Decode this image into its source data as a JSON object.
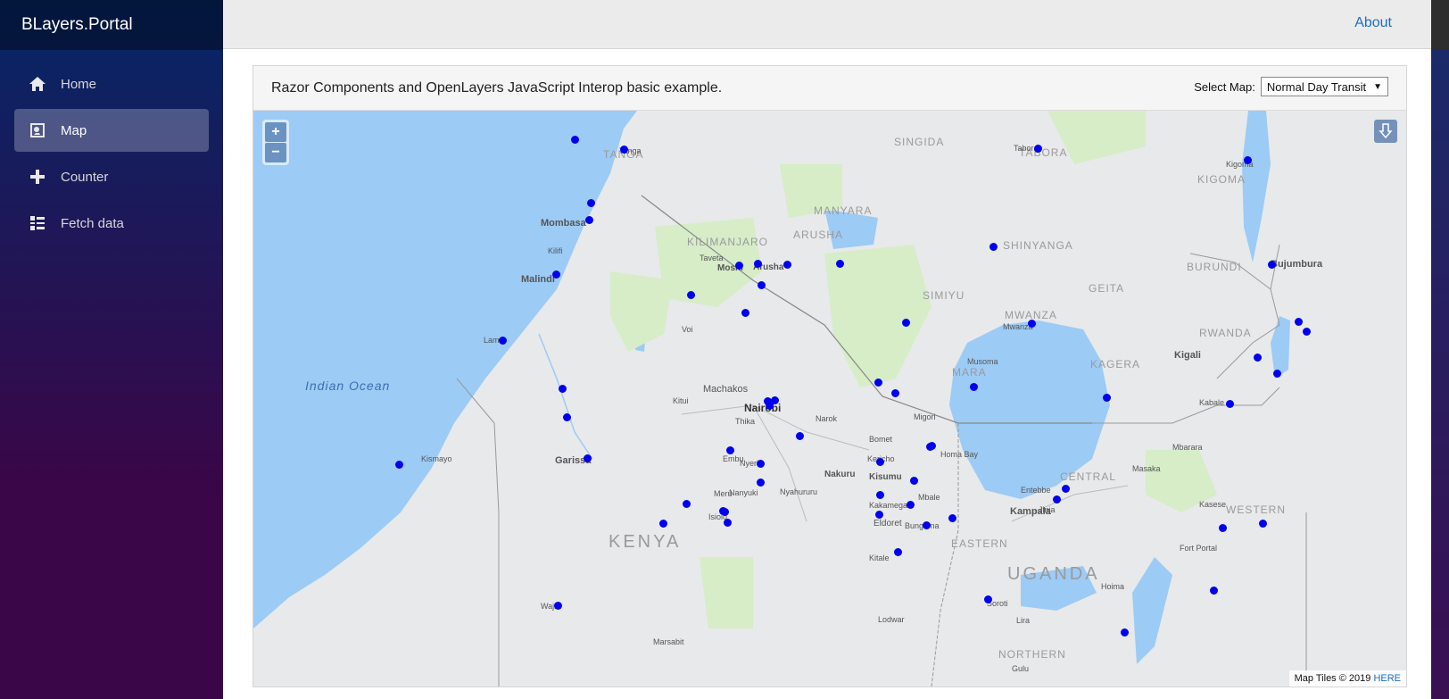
{
  "app": {
    "brand": "BLayers.Portal"
  },
  "sidebar": {
    "items": [
      {
        "label": "Home",
        "icon": "home-icon",
        "active": false
      },
      {
        "label": "Map",
        "icon": "map-icon",
        "active": true
      },
      {
        "label": "Counter",
        "icon": "plus-icon",
        "active": false
      },
      {
        "label": "Fetch data",
        "icon": "list-icon",
        "active": false
      }
    ]
  },
  "topbar": {
    "about_label": "About"
  },
  "card": {
    "title": "Razor Components and OpenLayers JavaScript Interop basic example.",
    "select_label": "Select Map:",
    "select_value": "Normal Day Transit"
  },
  "map": {
    "zoom_in": "+",
    "zoom_out": "−",
    "attribution_text": "Map Tiles © 2019 ",
    "attribution_link": "HERE",
    "ocean_label": "Indian Ocean",
    "country_labels": [
      "KENYA",
      "UGANDA"
    ],
    "region_labels": [
      "TANGA",
      "SINGIDA",
      "TABORA",
      "KIGOMA",
      "MANYARA",
      "KILIMANJARO",
      "ARUSHA",
      "SHINYANGA",
      "SIMIYU",
      "MWANZA",
      "GEITA",
      "BURUNDI",
      "KAGERA",
      "RWANDA",
      "MARA",
      "CENTRAL",
      "EASTERN",
      "WESTERN",
      "NORTHERN"
    ],
    "place_labels": [
      "Mombasa",
      "Malindi",
      "Kilifi",
      "Lamu",
      "Garissa",
      "Kismayo",
      "Nairobi",
      "Machakos",
      "Thika",
      "Nyeri",
      "Nanyuki",
      "Isiolo",
      "Moshi",
      "Arusha",
      "Kisumu",
      "Nakuru",
      "Eldoret",
      "Kampala",
      "Entebbe",
      "Kigali",
      "Bujumbura",
      "Mwanza",
      "Musoma",
      "Tanga",
      "Kakamega",
      "Kericho",
      "Bomet",
      "Narok",
      "Jinja",
      "Mbale",
      "Soroti",
      "Lira",
      "Gulu",
      "Hoima",
      "Fort Portal",
      "Kasese",
      "Masaka",
      "Mbarara",
      "Kabale",
      "Tabora",
      "Kigoma",
      "Homa Bay",
      "Migori",
      "Bungoma",
      "Kitale",
      "Marsabit",
      "Wajir",
      "Nyahururu",
      "Meru",
      "Embu",
      "Kitui",
      "Voi",
      "Taveta",
      "Lodwar"
    ],
    "marker_color": "#0000ee"
  }
}
